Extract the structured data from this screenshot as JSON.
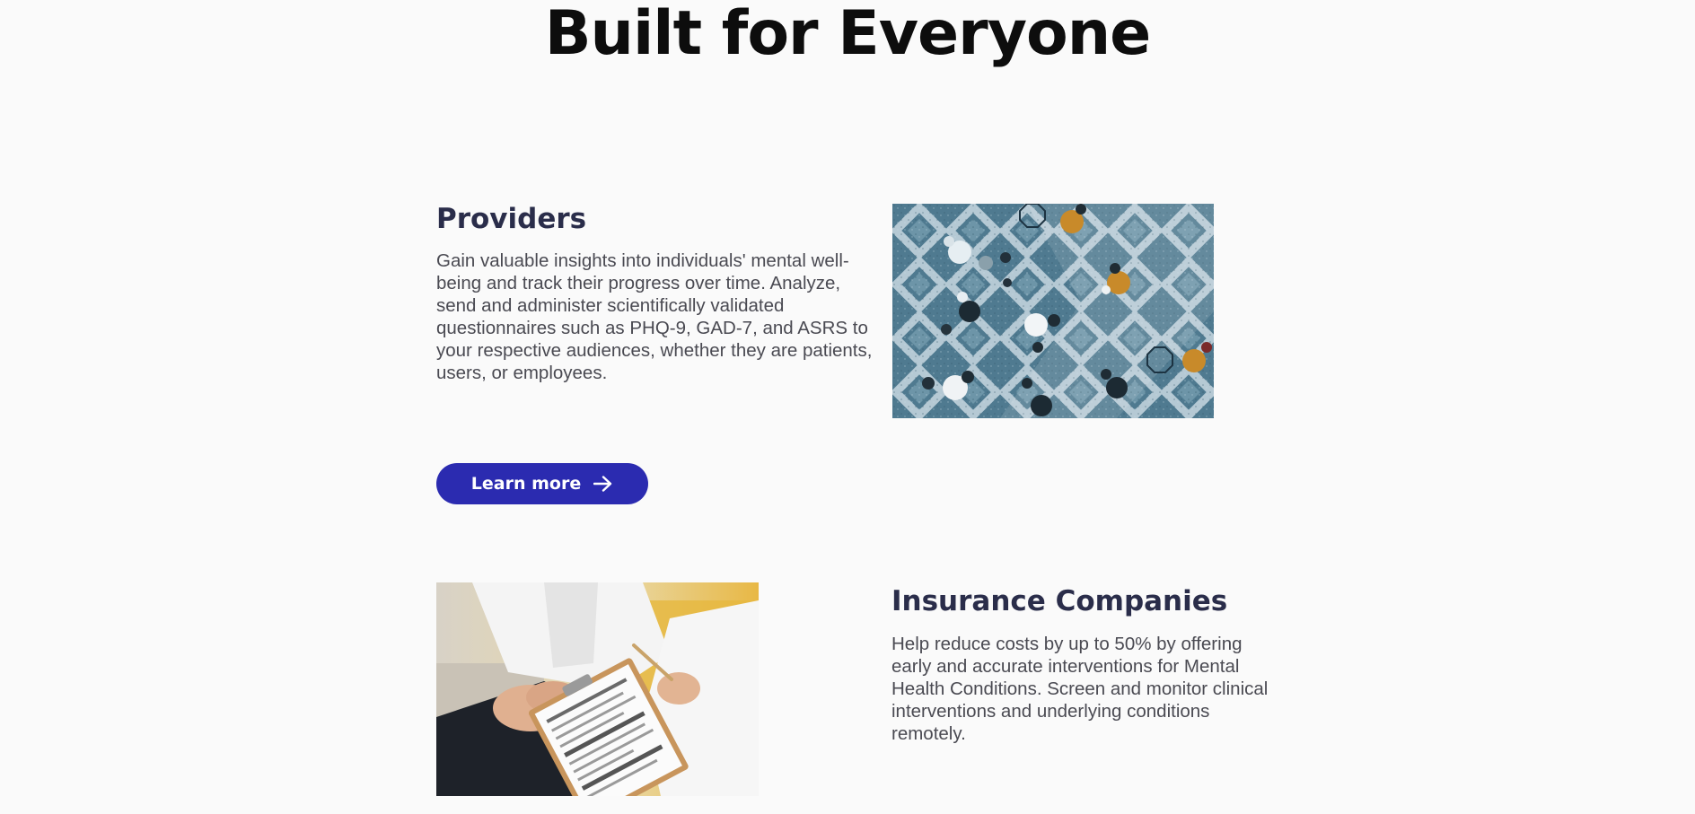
{
  "page": {
    "title": "Built for Everyone"
  },
  "sections": [
    {
      "heading": "Providers",
      "text": "Gain valuable insights into individuals' mental well-being and track their progress over time. Analyze, send and administer scientifically validated questionnaires such as PHQ-9, GAD-7, and ASRS to your respective audiences, whether they are patients, users, or employees.",
      "button_label": "Learn more",
      "button_icon": "arrow-right-icon",
      "image": "aerial-office-people-photo"
    },
    {
      "heading": "Insurance Companies",
      "text": "Help reduce costs by up to 50% by offering early and accurate interventions for Mental Health Conditions. Screen and monitor clinical interventions and underlying conditions remotely.",
      "image": "clipboard-consultation-photo"
    }
  ],
  "colors": {
    "background": "#fafafa",
    "title": "#0d0d0d",
    "heading": "#2a2d4a",
    "body_text": "#4a4a52",
    "button": "#2b2bb0",
    "button_text": "#ffffff"
  }
}
